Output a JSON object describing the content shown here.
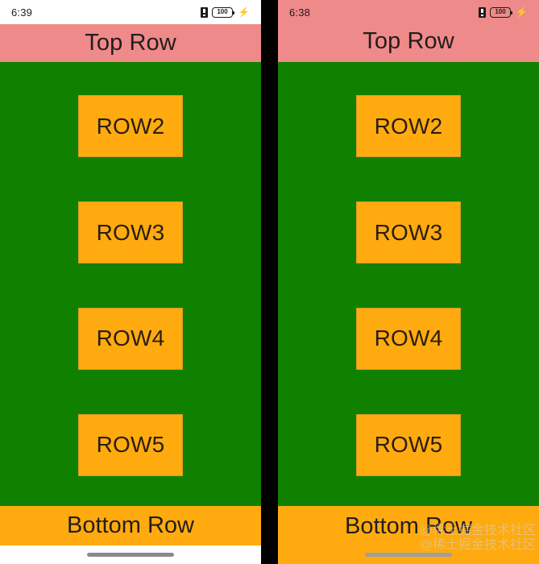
{
  "colors": {
    "divider": "#000000",
    "top_row_bg": "#ef8a8a",
    "body_bg": "#108000",
    "button_bg": "#ffab0f",
    "bottom_row_bg": "#ffab0f",
    "text_dark": "#241d1d",
    "status_bar_bg": "#ffffff"
  },
  "panels": [
    {
      "id": "left",
      "status": {
        "time": "6:39",
        "sim_icon": "sim-card-icon",
        "battery_level": "100",
        "battery_icon": "battery-icon",
        "charging_icon": "lightning-bolt-icon"
      },
      "top_row": {
        "label": "Top Row"
      },
      "buttons": [
        {
          "label": "ROW2"
        },
        {
          "label": "ROW3"
        },
        {
          "label": "ROW4"
        },
        {
          "label": "ROW5"
        }
      ],
      "bottom_row": {
        "label": "Bottom Row"
      },
      "nav": {
        "gesture_pill": "home-gesture-pill"
      }
    },
    {
      "id": "right",
      "status": {
        "time": "6:38",
        "sim_icon": "sim-card-icon",
        "battery_level": "100",
        "battery_icon": "battery-icon",
        "charging_icon": "lightning-bolt-icon"
      },
      "top_row": {
        "label": "Top Row"
      },
      "buttons": [
        {
          "label": "ROW2"
        },
        {
          "label": "ROW3"
        },
        {
          "label": "ROW4"
        },
        {
          "label": "ROW5"
        }
      ],
      "bottom_row": {
        "label": "Bottom Row"
      },
      "nav": {
        "gesture_pill": "home-gesture-pill"
      },
      "watermark": {
        "line1": "@稀土掘金技术社区",
        "line2": "@稀土掘金技术社区"
      }
    }
  ]
}
